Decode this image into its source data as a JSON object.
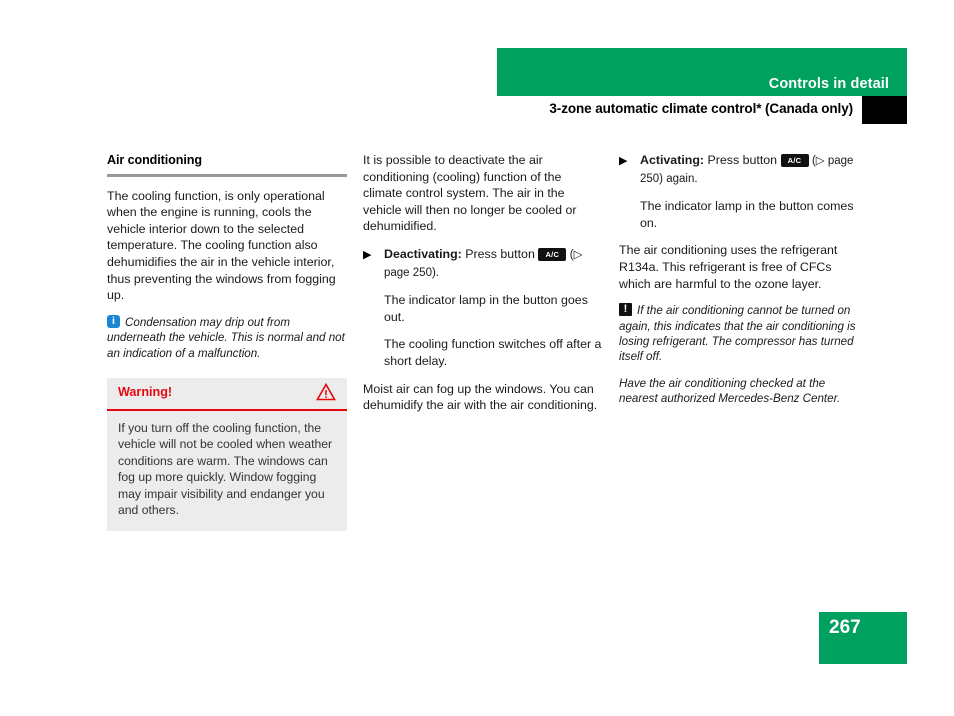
{
  "header": {
    "chapter_title": "Controls in detail",
    "subtitle": "3-zone automatic climate control* (Canada only)",
    "green_color": "#00a05f",
    "tab_marker_color": "#000000"
  },
  "footer": {
    "page_number": "267"
  },
  "left_column": {
    "heading": "Air conditioning",
    "intro_paragraph": "The cooling function, is only operational when the engine is running, cools the vehicle interior down to the selected temperature. The cooling function also dehumidifies the air in the vehicle interior, thus preventing the windows from fogging up.",
    "info_note": {
      "icon": "info-icon",
      "text": "Condensation may drip out from underneath the vehicle. This is normal and not an indication of a malfunction."
    },
    "warning": {
      "title": "Warning!",
      "icon": "warning-triangle-icon",
      "accent_color": "#e8070f",
      "background_color": "#ececec",
      "body": "If you turn off the cooling function, the vehicle will not be cooled when weather conditions are warm. The windows can fog up more quickly. Window fogging may impair visibility and endanger you and others."
    }
  },
  "mid_column": {
    "intro_paragraph": "It is possible to deactivate the air conditioning (cooling) function of the climate control system. The air in the vehicle will then no longer be cooled or dehumidified.",
    "step": {
      "bullet": "▶",
      "label": "Deactivating:",
      "text_before_button": "Press button",
      "button_label": "A/C",
      "reference": "(▷ page 250)."
    },
    "result_1": "The indicator lamp in the button goes out.",
    "result_2": "The cooling function switches off after a short delay.",
    "closing_paragraph": "Moist air can fog up the windows. You can dehumidify the air with the air conditioning."
  },
  "right_column": {
    "step": {
      "bullet": "▶",
      "label": "Activating:",
      "text_before_button": "Press button",
      "button_label": "A/C",
      "reference": "(▷ page 250) again."
    },
    "result_1": "The indicator lamp in the button comes on.",
    "refrigerant_paragraph": "The air conditioning uses the refrigerant R134a. This refrigerant is free of CFCs which are harmful to the ozone layer.",
    "alert_note": {
      "icon": "alert-icon",
      "text": "If the air conditioning cannot be turned on again, this indicates that the air conditioning is losing refrigerant. The compressor has turned itself off."
    },
    "alert_follow_up": "Have the air conditioning checked at the nearest authorized Mercedes-Benz Center."
  }
}
